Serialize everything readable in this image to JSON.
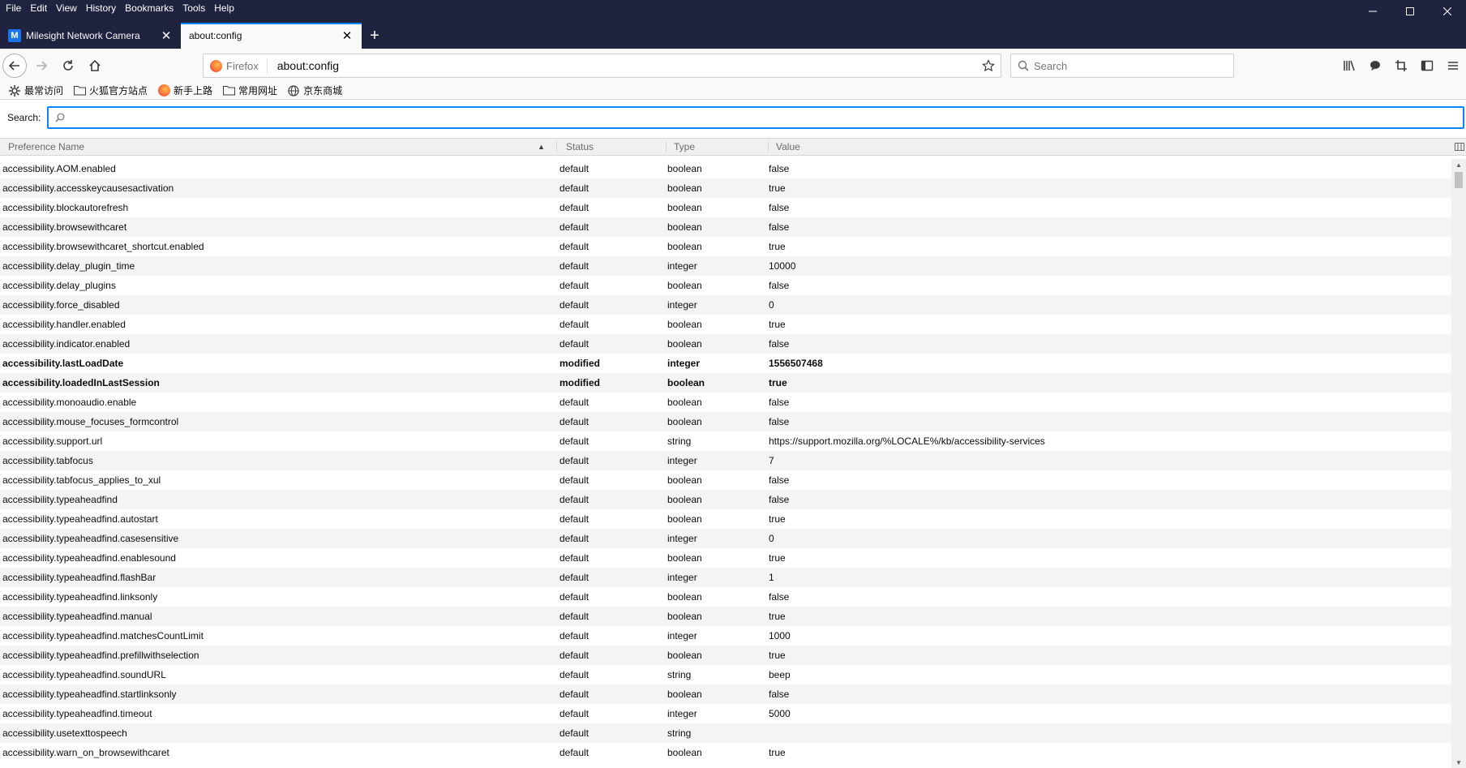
{
  "menu": [
    "File",
    "Edit",
    "View",
    "History",
    "Bookmarks",
    "Tools",
    "Help"
  ],
  "tabs": [
    {
      "label": "Milesight Network Camera",
      "favicon": "M",
      "active": false
    },
    {
      "label": "about:config",
      "active": true
    }
  ],
  "urlbar": {
    "identity": "Firefox",
    "url": "about:config"
  },
  "searchbar": {
    "placeholder": "Search"
  },
  "bookmarks": [
    {
      "label": "最常访问",
      "icon": "gear-icon"
    },
    {
      "label": "火狐官方站点",
      "icon": "folder-icon"
    },
    {
      "label": "新手上路",
      "icon": "firefox-icon"
    },
    {
      "label": "常用网址",
      "icon": "folder-icon"
    },
    {
      "label": "京东商城",
      "icon": "globe-icon"
    }
  ],
  "config_search": {
    "label": "Search:",
    "value": ""
  },
  "columns": {
    "name": "Preference Name",
    "status": "Status",
    "type": "Type",
    "value": "Value"
  },
  "rows": [
    {
      "name": "accessibility.AOM.enabled",
      "status": "default",
      "type": "boolean",
      "value": "false"
    },
    {
      "name": "accessibility.accesskeycausesactivation",
      "status": "default",
      "type": "boolean",
      "value": "true"
    },
    {
      "name": "accessibility.blockautorefresh",
      "status": "default",
      "type": "boolean",
      "value": "false"
    },
    {
      "name": "accessibility.browsewithcaret",
      "status": "default",
      "type": "boolean",
      "value": "false"
    },
    {
      "name": "accessibility.browsewithcaret_shortcut.enabled",
      "status": "default",
      "type": "boolean",
      "value": "true"
    },
    {
      "name": "accessibility.delay_plugin_time",
      "status": "default",
      "type": "integer",
      "value": "10000"
    },
    {
      "name": "accessibility.delay_plugins",
      "status": "default",
      "type": "boolean",
      "value": "false"
    },
    {
      "name": "accessibility.force_disabled",
      "status": "default",
      "type": "integer",
      "value": "0"
    },
    {
      "name": "accessibility.handler.enabled",
      "status": "default",
      "type": "boolean",
      "value": "true"
    },
    {
      "name": "accessibility.indicator.enabled",
      "status": "default",
      "type": "boolean",
      "value": "false"
    },
    {
      "name": "accessibility.lastLoadDate",
      "status": "modified",
      "type": "integer",
      "value": "1556507468"
    },
    {
      "name": "accessibility.loadedInLastSession",
      "status": "modified",
      "type": "boolean",
      "value": "true"
    },
    {
      "name": "accessibility.monoaudio.enable",
      "status": "default",
      "type": "boolean",
      "value": "false"
    },
    {
      "name": "accessibility.mouse_focuses_formcontrol",
      "status": "default",
      "type": "boolean",
      "value": "false"
    },
    {
      "name": "accessibility.support.url",
      "status": "default",
      "type": "string",
      "value": "https://support.mozilla.org/%LOCALE%/kb/accessibility-services"
    },
    {
      "name": "accessibility.tabfocus",
      "status": "default",
      "type": "integer",
      "value": "7"
    },
    {
      "name": "accessibility.tabfocus_applies_to_xul",
      "status": "default",
      "type": "boolean",
      "value": "false"
    },
    {
      "name": "accessibility.typeaheadfind",
      "status": "default",
      "type": "boolean",
      "value": "false"
    },
    {
      "name": "accessibility.typeaheadfind.autostart",
      "status": "default",
      "type": "boolean",
      "value": "true"
    },
    {
      "name": "accessibility.typeaheadfind.casesensitive",
      "status": "default",
      "type": "integer",
      "value": "0"
    },
    {
      "name": "accessibility.typeaheadfind.enablesound",
      "status": "default",
      "type": "boolean",
      "value": "true"
    },
    {
      "name": "accessibility.typeaheadfind.flashBar",
      "status": "default",
      "type": "integer",
      "value": "1"
    },
    {
      "name": "accessibility.typeaheadfind.linksonly",
      "status": "default",
      "type": "boolean",
      "value": "false"
    },
    {
      "name": "accessibility.typeaheadfind.manual",
      "status": "default",
      "type": "boolean",
      "value": "true"
    },
    {
      "name": "accessibility.typeaheadfind.matchesCountLimit",
      "status": "default",
      "type": "integer",
      "value": "1000"
    },
    {
      "name": "accessibility.typeaheadfind.prefillwithselection",
      "status": "default",
      "type": "boolean",
      "value": "true"
    },
    {
      "name": "accessibility.typeaheadfind.soundURL",
      "status": "default",
      "type": "string",
      "value": "beep"
    },
    {
      "name": "accessibility.typeaheadfind.startlinksonly",
      "status": "default",
      "type": "boolean",
      "value": "false"
    },
    {
      "name": "accessibility.typeaheadfind.timeout",
      "status": "default",
      "type": "integer",
      "value": "5000"
    },
    {
      "name": "accessibility.usetexttospeech",
      "status": "default",
      "type": "string",
      "value": ""
    },
    {
      "name": "accessibility.warn_on_browsewithcaret",
      "status": "default",
      "type": "boolean",
      "value": "true"
    }
  ]
}
